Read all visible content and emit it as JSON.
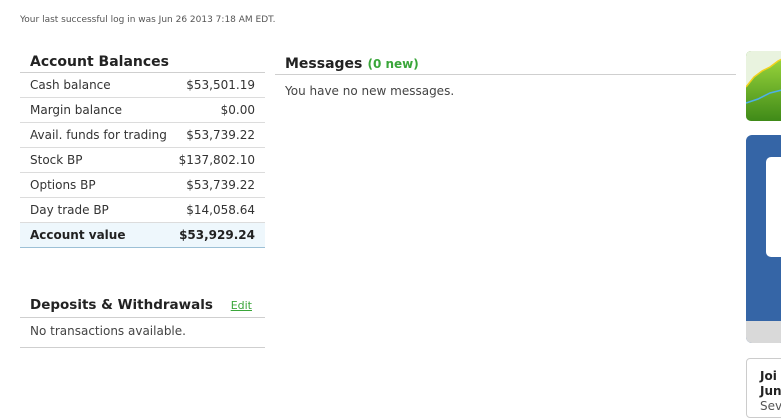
{
  "last_login": "Your last successful log in was Jun 26 2013 7:18 AM EDT.",
  "balances": {
    "title": "Account Balances",
    "rows": [
      {
        "label": "Cash balance",
        "value": "$53,501.19"
      },
      {
        "label": "Margin balance",
        "value": "$0.00"
      },
      {
        "label": "Avail. funds for trading",
        "value": "$53,739.22"
      },
      {
        "label": "Stock BP",
        "value": "$137,802.10"
      },
      {
        "label": "Options BP",
        "value": "$53,739.22"
      },
      {
        "label": "Day trade BP",
        "value": "$14,058.64"
      }
    ],
    "total": {
      "label": "Account value",
      "value": "$53,929.24"
    }
  },
  "deposits": {
    "title": "Deposits & Withdrawals",
    "edit_label": "Edit",
    "empty_text": "No transactions available."
  },
  "messages": {
    "title": "Messages",
    "new_count": "(0 new)",
    "body": "You have no new messages."
  },
  "promo": {
    "line1": "Joi",
    "line2": "Jun",
    "line3": "Sev"
  },
  "colors": {
    "accent_green": "#3aa63a",
    "widget_blue": "#3565a6",
    "total_row_bg": "#eef7fc"
  }
}
